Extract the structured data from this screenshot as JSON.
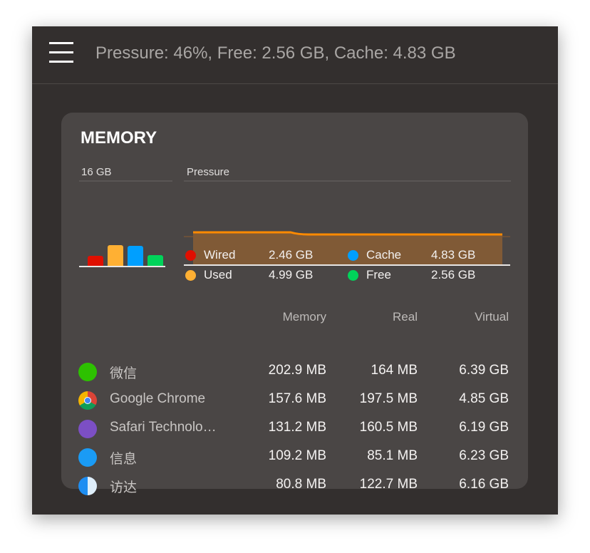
{
  "header": {
    "title": "Pressure: 46%, Free: 2.56 GB, Cache: 4.83 GB",
    "menu_icon": "hamburger-icon"
  },
  "card": {
    "title": "MEMORY",
    "total_label": "16 GB",
    "pressure_label": "Pressure",
    "pressure_percent": 46
  },
  "breakdown": [
    {
      "name": "Wired",
      "value": "2.46 GB",
      "gb": 2.46,
      "color": "#e00f00"
    },
    {
      "name": "Used",
      "value": "4.99 GB",
      "gb": 4.99,
      "color": "#ffb033"
    },
    {
      "name": "Cache",
      "value": "4.83 GB",
      "gb": 4.83,
      "color": "#009fff"
    },
    {
      "name": "Free",
      "value": "2.56 GB",
      "gb": 2.56,
      "color": "#00d35a"
    }
  ],
  "table": {
    "headers": [
      "Memory",
      "Real",
      "Virtual"
    ],
    "rows": [
      {
        "name": "微信",
        "icon": "wechat-icon",
        "memory": "202.9 MB",
        "real": "164 MB",
        "virtual": "6.39 GB"
      },
      {
        "name": "Google Chrome",
        "icon": "chrome-icon",
        "memory": "157.6 MB",
        "real": "197.5 MB",
        "virtual": "4.85 GB"
      },
      {
        "name": "Safari Technolo…",
        "icon": "safari-icon",
        "memory": "131.2 MB",
        "real": "160.5 MB",
        "virtual": "6.19 GB"
      },
      {
        "name": "信息",
        "icon": "messages-icon",
        "memory": "109.2 MB",
        "real": "85.1 MB",
        "virtual": "6.23 GB"
      },
      {
        "name": "访达",
        "icon": "finder-icon",
        "memory": "80.8 MB",
        "real": "122.7 MB",
        "virtual": "6.16 GB"
      }
    ]
  }
}
